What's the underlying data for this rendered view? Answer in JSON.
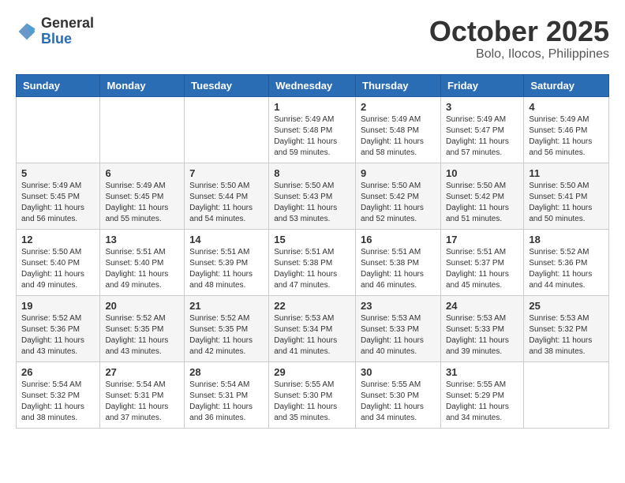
{
  "header": {
    "logo_general": "General",
    "logo_blue": "Blue",
    "month_title": "October 2025",
    "location": "Bolo, Ilocos, Philippines"
  },
  "days_of_week": [
    "Sunday",
    "Monday",
    "Tuesday",
    "Wednesday",
    "Thursday",
    "Friday",
    "Saturday"
  ],
  "weeks": [
    [
      {
        "day": "",
        "info": ""
      },
      {
        "day": "",
        "info": ""
      },
      {
        "day": "",
        "info": ""
      },
      {
        "day": "1",
        "info": "Sunrise: 5:49 AM\nSunset: 5:48 PM\nDaylight: 11 hours\nand 59 minutes."
      },
      {
        "day": "2",
        "info": "Sunrise: 5:49 AM\nSunset: 5:48 PM\nDaylight: 11 hours\nand 58 minutes."
      },
      {
        "day": "3",
        "info": "Sunrise: 5:49 AM\nSunset: 5:47 PM\nDaylight: 11 hours\nand 57 minutes."
      },
      {
        "day": "4",
        "info": "Sunrise: 5:49 AM\nSunset: 5:46 PM\nDaylight: 11 hours\nand 56 minutes."
      }
    ],
    [
      {
        "day": "5",
        "info": "Sunrise: 5:49 AM\nSunset: 5:45 PM\nDaylight: 11 hours\nand 56 minutes."
      },
      {
        "day": "6",
        "info": "Sunrise: 5:49 AM\nSunset: 5:45 PM\nDaylight: 11 hours\nand 55 minutes."
      },
      {
        "day": "7",
        "info": "Sunrise: 5:50 AM\nSunset: 5:44 PM\nDaylight: 11 hours\nand 54 minutes."
      },
      {
        "day": "8",
        "info": "Sunrise: 5:50 AM\nSunset: 5:43 PM\nDaylight: 11 hours\nand 53 minutes."
      },
      {
        "day": "9",
        "info": "Sunrise: 5:50 AM\nSunset: 5:42 PM\nDaylight: 11 hours\nand 52 minutes."
      },
      {
        "day": "10",
        "info": "Sunrise: 5:50 AM\nSunset: 5:42 PM\nDaylight: 11 hours\nand 51 minutes."
      },
      {
        "day": "11",
        "info": "Sunrise: 5:50 AM\nSunset: 5:41 PM\nDaylight: 11 hours\nand 50 minutes."
      }
    ],
    [
      {
        "day": "12",
        "info": "Sunrise: 5:50 AM\nSunset: 5:40 PM\nDaylight: 11 hours\nand 49 minutes."
      },
      {
        "day": "13",
        "info": "Sunrise: 5:51 AM\nSunset: 5:40 PM\nDaylight: 11 hours\nand 49 minutes."
      },
      {
        "day": "14",
        "info": "Sunrise: 5:51 AM\nSunset: 5:39 PM\nDaylight: 11 hours\nand 48 minutes."
      },
      {
        "day": "15",
        "info": "Sunrise: 5:51 AM\nSunset: 5:38 PM\nDaylight: 11 hours\nand 47 minutes."
      },
      {
        "day": "16",
        "info": "Sunrise: 5:51 AM\nSunset: 5:38 PM\nDaylight: 11 hours\nand 46 minutes."
      },
      {
        "day": "17",
        "info": "Sunrise: 5:51 AM\nSunset: 5:37 PM\nDaylight: 11 hours\nand 45 minutes."
      },
      {
        "day": "18",
        "info": "Sunrise: 5:52 AM\nSunset: 5:36 PM\nDaylight: 11 hours\nand 44 minutes."
      }
    ],
    [
      {
        "day": "19",
        "info": "Sunrise: 5:52 AM\nSunset: 5:36 PM\nDaylight: 11 hours\nand 43 minutes."
      },
      {
        "day": "20",
        "info": "Sunrise: 5:52 AM\nSunset: 5:35 PM\nDaylight: 11 hours\nand 43 minutes."
      },
      {
        "day": "21",
        "info": "Sunrise: 5:52 AM\nSunset: 5:35 PM\nDaylight: 11 hours\nand 42 minutes."
      },
      {
        "day": "22",
        "info": "Sunrise: 5:53 AM\nSunset: 5:34 PM\nDaylight: 11 hours\nand 41 minutes."
      },
      {
        "day": "23",
        "info": "Sunrise: 5:53 AM\nSunset: 5:33 PM\nDaylight: 11 hours\nand 40 minutes."
      },
      {
        "day": "24",
        "info": "Sunrise: 5:53 AM\nSunset: 5:33 PM\nDaylight: 11 hours\nand 39 minutes."
      },
      {
        "day": "25",
        "info": "Sunrise: 5:53 AM\nSunset: 5:32 PM\nDaylight: 11 hours\nand 38 minutes."
      }
    ],
    [
      {
        "day": "26",
        "info": "Sunrise: 5:54 AM\nSunset: 5:32 PM\nDaylight: 11 hours\nand 38 minutes."
      },
      {
        "day": "27",
        "info": "Sunrise: 5:54 AM\nSunset: 5:31 PM\nDaylight: 11 hours\nand 37 minutes."
      },
      {
        "day": "28",
        "info": "Sunrise: 5:54 AM\nSunset: 5:31 PM\nDaylight: 11 hours\nand 36 minutes."
      },
      {
        "day": "29",
        "info": "Sunrise: 5:55 AM\nSunset: 5:30 PM\nDaylight: 11 hours\nand 35 minutes."
      },
      {
        "day": "30",
        "info": "Sunrise: 5:55 AM\nSunset: 5:30 PM\nDaylight: 11 hours\nand 34 minutes."
      },
      {
        "day": "31",
        "info": "Sunrise: 5:55 AM\nSunset: 5:29 PM\nDaylight: 11 hours\nand 34 minutes."
      },
      {
        "day": "",
        "info": ""
      }
    ]
  ]
}
